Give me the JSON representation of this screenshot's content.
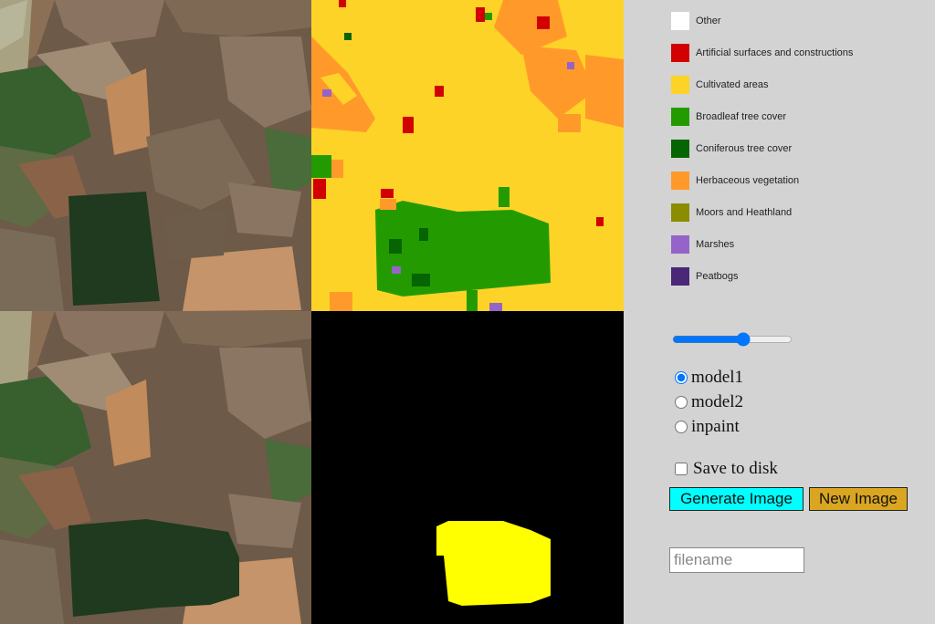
{
  "legend": [
    {
      "label": "Other",
      "color": "#ffffff"
    },
    {
      "label": "Artificial surfaces and constructions",
      "color": "#d20000"
    },
    {
      "label": "Cultivated areas",
      "color": "#fdd327"
    },
    {
      "label": "Broadleaf tree cover",
      "color": "#239b00"
    },
    {
      "label": "Coniferous tree cover",
      "color": "#066402"
    },
    {
      "label": "Herbaceous vegetation",
      "color": "#ff9a2a"
    },
    {
      "label": "Moors and Heathland",
      "color": "#8c8c00"
    },
    {
      "label": "Marshes",
      "color": "#9664c8"
    },
    {
      "label": "Peatbogs",
      "color": "#4b2778"
    }
  ],
  "controls": {
    "slider_value": 60,
    "radios": [
      {
        "label": "model1",
        "checked": true
      },
      {
        "label": "model2",
        "checked": false
      },
      {
        "label": "inpaint",
        "checked": false
      }
    ],
    "save_label": "Save to disk",
    "save_checked": false,
    "generate_label": "Generate Image",
    "new_image_label": "New Image",
    "filename_placeholder": "filename"
  },
  "colors": {
    "mask_fill": "#ffff00",
    "generate_button": "#00ffff",
    "new_image_button": "#daa520"
  }
}
